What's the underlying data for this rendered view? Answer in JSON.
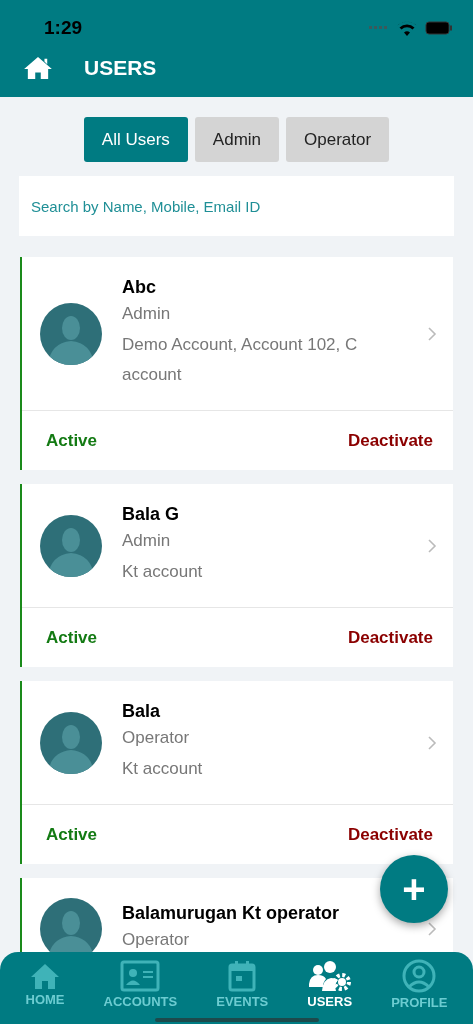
{
  "status_bar": {
    "time": "1:29"
  },
  "header": {
    "title": "USERS"
  },
  "filters": [
    {
      "label": "All Users",
      "selected": true
    },
    {
      "label": "Admin",
      "selected": false
    },
    {
      "label": "Operator",
      "selected": false
    }
  ],
  "search": {
    "placeholder": "Search by Name, Mobile, Email ID"
  },
  "users": [
    {
      "name": "Abc",
      "role": "Admin",
      "accounts": "Demo Account, Account 102, C account",
      "status": "Active",
      "action": "Deactivate"
    },
    {
      "name": "Bala G",
      "role": "Admin",
      "accounts": "Kt account",
      "status": "Active",
      "action": "Deactivate"
    },
    {
      "name": "Bala",
      "role": "Operator",
      "accounts": "Kt account",
      "status": "Active",
      "action": "Deactivate"
    },
    {
      "name": "Balamurugan  Kt operator",
      "role": "Operator"
    }
  ],
  "fab": {
    "label": "+"
  },
  "tab_bar": [
    {
      "label": "HOME",
      "kind": "home",
      "selected": false
    },
    {
      "label": "ACCOUNTS",
      "kind": "accounts",
      "selected": false
    },
    {
      "label": "EVENTS",
      "kind": "events",
      "selected": false
    },
    {
      "label": "USERS",
      "kind": "users",
      "selected": true
    },
    {
      "label": "PROFILE",
      "kind": "profile",
      "selected": false
    }
  ]
}
